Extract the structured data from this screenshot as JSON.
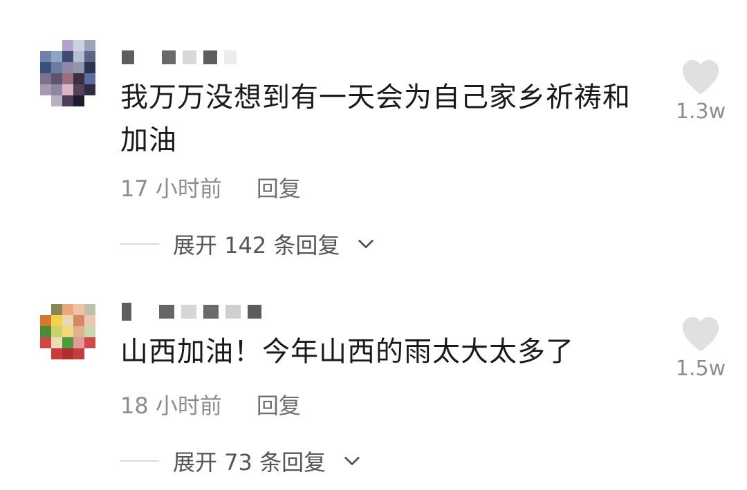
{
  "comments": [
    {
      "text": "我万万没想到有一天会为自己家乡祈祷和加油",
      "time": "17 小时前",
      "reply_label": "回复",
      "expand_label": "展开 142 条回复",
      "likes": "1.3w",
      "avatar": "pixelated"
    },
    {
      "text": "山西加油！今年山西的雨太大太多了",
      "time": "18 小时前",
      "reply_label": "回复",
      "expand_label": "展开 73 条回复",
      "likes": "1.5w",
      "avatar": "pixelated"
    }
  ],
  "icons": {
    "like": "heart-icon",
    "expand": "chevron-down-icon"
  },
  "colors": {
    "text": "#1a1a1a",
    "meta": "#8c8c8c",
    "heart": "#e0e0e0"
  }
}
